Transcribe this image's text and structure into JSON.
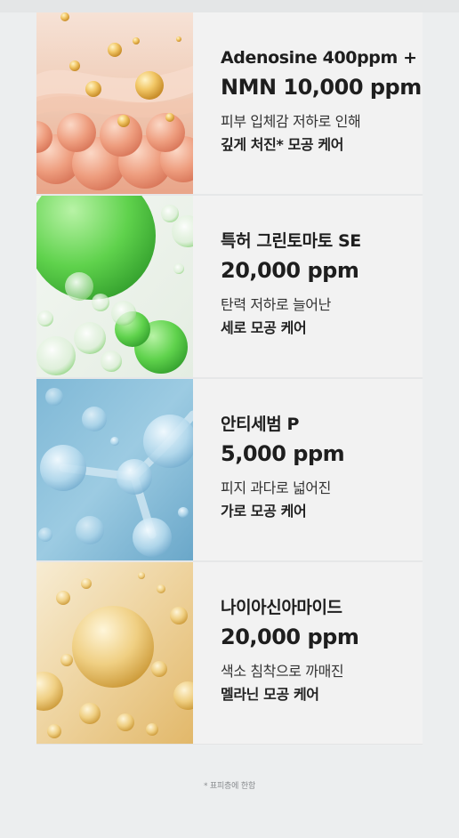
{
  "ingredients": [
    {
      "name": "Adenosine 400ppm +",
      "concentration": "NMN 10,000 ppm",
      "desc_line1": "피부 입체감 저하로 인해",
      "desc_line2": "깊게 처진* 모공 케어",
      "image": "peach-bubble-texture-image"
    },
    {
      "name": "특허 그린토마토 SE",
      "concentration": "20,000 ppm",
      "desc_line1": "탄력 저하로 늘어난",
      "desc_line2": "세로 모공 케어",
      "image": "green-bubble-image"
    },
    {
      "name": "안티세범 P",
      "concentration": "5,000 ppm",
      "desc_line1": "피지 과다로 넓어진",
      "desc_line2": "가로 모공 케어",
      "image": "blue-molecule-image"
    },
    {
      "name": "나이아신아마이드",
      "concentration": "20,000 ppm",
      "desc_line1": "색소 침착으로 까매진",
      "desc_line2": "멜라닌 모공 케어",
      "image": "gold-bubble-image"
    }
  ],
  "footnote": "* 표피층에 한함"
}
